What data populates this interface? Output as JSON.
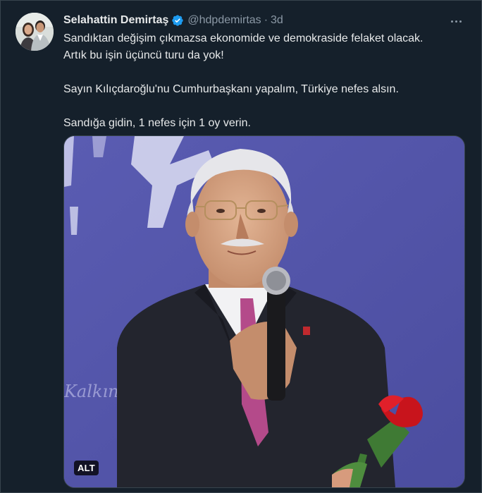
{
  "tweet": {
    "author_name": "Selahattin Demirtaş",
    "author_handle": "@hdpdemirtas",
    "separator": "·",
    "timestamp": "3d",
    "verified": true,
    "lines": [
      "Sandıktan değişim çıkmazsa ekonomide ve demokraside felaket olacak.",
      "Artık bu işin üçüncü turu da yok!",
      "Sayın Kılıçdaroğlu'nu Cumhurbaşkanı yapalım, Türkiye nefes alsın.",
      "Sandığa gidin, 1 nefes için 1 oy verin."
    ],
    "media": {
      "alt_label": "ALT"
    }
  },
  "icons": {
    "verified": "verified-badge-icon",
    "more": "more-options-icon"
  },
  "colors": {
    "background": "#15202b",
    "text_primary": "#e7e9ea",
    "text_secondary": "#8b98a5",
    "verified_blue": "#1d9bf0",
    "border": "#38444d"
  }
}
